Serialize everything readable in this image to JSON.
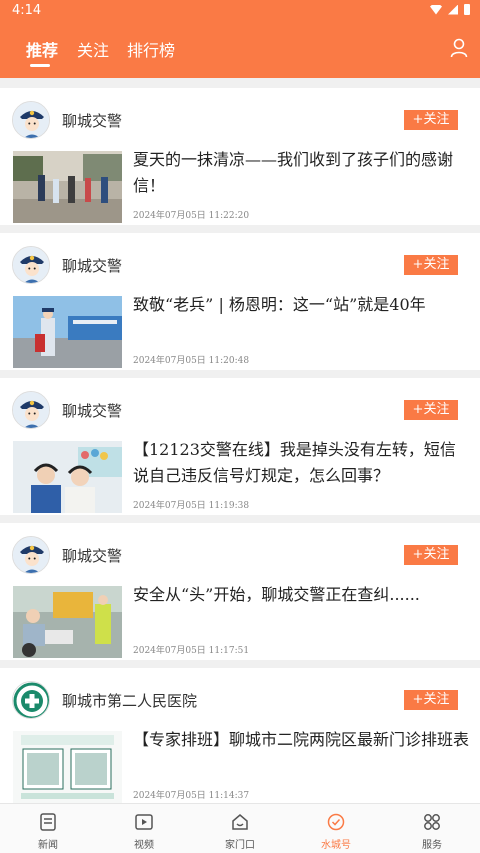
{
  "status": {
    "time": "4:14"
  },
  "tabs": [
    {
      "label": "推荐"
    },
    {
      "label": "关注"
    },
    {
      "label": "排行榜"
    }
  ],
  "feed": [
    {
      "author": "聊城交警",
      "follow": "+关注",
      "title": "夏天的一抹清凉——我们收到了孩子们的感谢信！",
      "time": "2024年07月05日 11:22:20"
    },
    {
      "author": "聊城交警",
      "follow": "+关注",
      "title": "致敬“老兵” | 杨恩明：这一“站”就是40年",
      "time": "2024年07月05日 11:20:48"
    },
    {
      "author": "聊城交警",
      "follow": "+关注",
      "title": "【12123交警在线】我是掉头没有左转，短信说自己违反信号灯规定，怎么回事？",
      "time": "2024年07月05日 11:19:38"
    },
    {
      "author": "聊城交警",
      "follow": "+关注",
      "title": "安全从“头”开始，聊城交警正在查纠......",
      "time": "2024年07月05日 11:17:51"
    },
    {
      "author": "聊城市第二人民医院",
      "follow": "+关注",
      "title": "【专家排班】聊城市二院两院区最新门诊排班表",
      "time": "2024年07月05日 11:14:37"
    }
  ],
  "bottom_nav": [
    {
      "label": "新闻",
      "icon": "news-icon"
    },
    {
      "label": "视频",
      "icon": "video-icon"
    },
    {
      "label": "家门口",
      "icon": "home-door-icon"
    },
    {
      "label": "水城号",
      "icon": "shuicheng-icon"
    },
    {
      "label": "服务",
      "icon": "services-icon"
    }
  ],
  "colors": {
    "accent": "#fa7a45"
  }
}
